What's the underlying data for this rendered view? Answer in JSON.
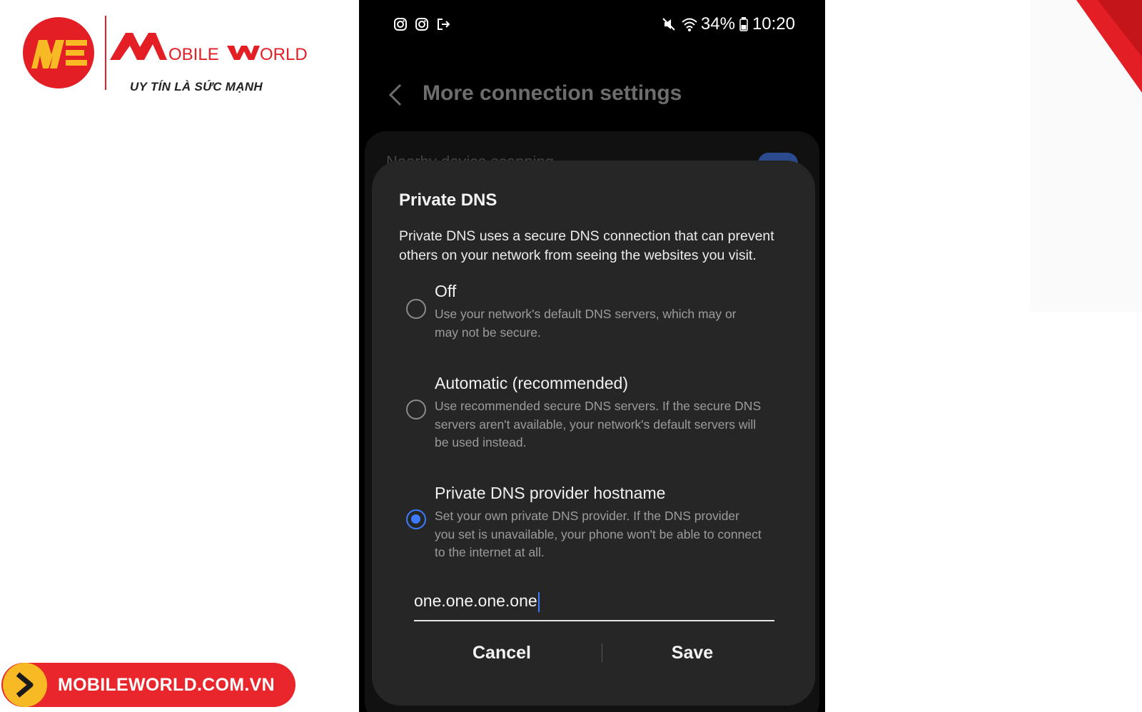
{
  "brand": {
    "name": "MOBILE WORLD",
    "slogan": "UY TÍN LÀ SỨC MẠNH",
    "website": "MOBILEWORLD.COM.VN",
    "accent_color": "#e31e24",
    "secondary_color": "#f7b924"
  },
  "status_bar": {
    "left_icons": [
      "instagram-icon",
      "instagram-icon",
      "exit-icon"
    ],
    "right_icons": [
      "mute-icon",
      "wifi-icon"
    ],
    "battery": "34%",
    "time": "10:20"
  },
  "header": {
    "title": "More connection settings"
  },
  "background_list": {
    "first_item_label": "Nearby device scanning"
  },
  "dialog": {
    "title": "Private DNS",
    "description": "Private DNS uses a secure DNS connection that can prevent others on your network from seeing the websites you visit.",
    "options": [
      {
        "title": "Off",
        "description": "Use your network's default DNS servers, which may or may not be secure.",
        "selected": false
      },
      {
        "title": "Automatic (recommended)",
        "description": "Use recommended secure DNS servers. If the secure DNS servers aren't available, your network's default servers will be used instead.",
        "selected": false
      },
      {
        "title": "Private DNS provider hostname",
        "description": "Set your own private DNS provider. If the DNS provider you set is unavailable, your phone won't be able to connect to the internet at all.",
        "selected": true
      }
    ],
    "hostname_value": "one.one.one.one",
    "cancel_label": "Cancel",
    "save_label": "Save",
    "accent_color": "#3b7bff"
  }
}
